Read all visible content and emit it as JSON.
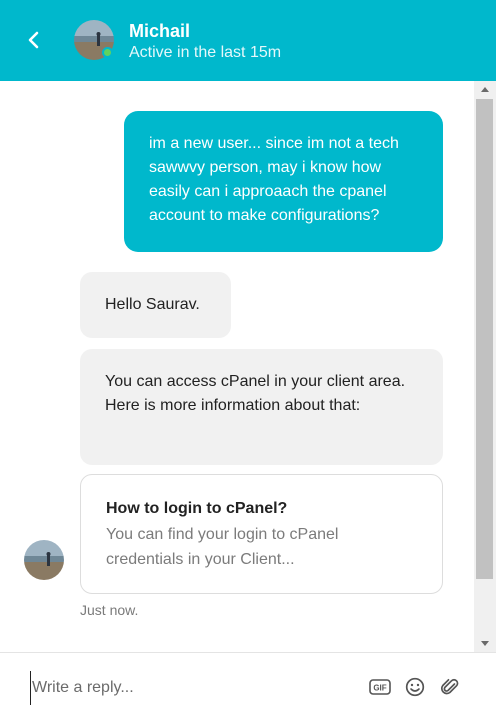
{
  "header": {
    "agent_name": "Michail",
    "status": "Active in the last 15m",
    "back_icon": "chevron-left-icon",
    "bg_color": "#00b8cc",
    "online_color": "#5fd35f"
  },
  "messages": {
    "user_message": "im a new user... since im not a tech sawwvy person, may i know how easily can i approaach the cpanel account to make configurations?",
    "agent_greeting": "Hello Saurav.",
    "agent_info": "You can access cPanel in your client area. Here is more information about that:",
    "article": {
      "title": "How to login to cPanel?",
      "description": "You can find your login to cPanel credentials in your Client..."
    },
    "timestamp": "Just now."
  },
  "composer": {
    "placeholder": "Write a reply...",
    "gif_label": "GIF",
    "icons": [
      "gif-icon",
      "emoji-icon",
      "attachment-icon"
    ]
  }
}
